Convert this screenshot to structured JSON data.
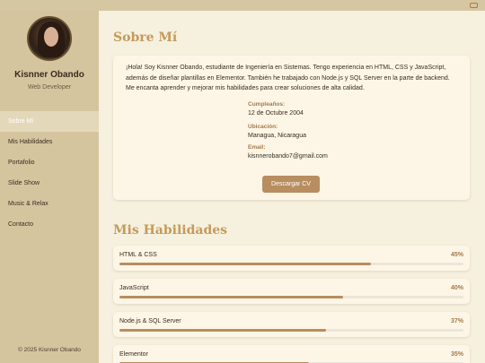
{
  "profile": {
    "name": "Kisnner Obando",
    "role": "Web Developer"
  },
  "nav": {
    "items": [
      {
        "label": "Sobre Mí",
        "active": true
      },
      {
        "label": "Mis Habilidades"
      },
      {
        "label": "Portafolio"
      },
      {
        "label": "Slide Show"
      },
      {
        "label": "Music & Relax"
      },
      {
        "label": "Contacto"
      }
    ]
  },
  "footer": {
    "text": "© 2025 Kisnner Obando"
  },
  "about": {
    "title": "Sobre Mí",
    "text": "¡Hola! Soy Kisnner Obando, estudiante de Ingeniería en Sistemas. Tengo experiencia en HTML, CSS y JavaScript, además de diseñar plantillas en Elementor. También he trabajado con Node.js y SQL Server en la parte de backend. Me encanta aprender y mejorar mis habilidades para crear soluciones de alta calidad.",
    "birthday_label": "Cumpleaños:",
    "birthday_value": "12 de Octubre 2004",
    "location_label": "Ubicación:",
    "location_value": "Managua, Nicaragua",
    "email_label": "Email:",
    "email_value": "kisnnerobando7@gmail.com",
    "cv_button": "Descargar CV"
  },
  "skills": {
    "title": "Mis Habilidades",
    "items": [
      {
        "name": "HTML & CSS",
        "percent_label": "45%",
        "level": 0.73
      },
      {
        "name": "JavaScript",
        "percent_label": "40%",
        "level": 0.65
      },
      {
        "name": "Node.js & SQL Server",
        "percent_label": "37%",
        "level": 0.6
      },
      {
        "name": "Elementor",
        "percent_label": "35%",
        "level": 0.55
      }
    ]
  },
  "colors": {
    "accent": "#b88d60",
    "title": "#c49a5c",
    "sidebar": "#d5c59f",
    "background": "#f6f1de"
  }
}
